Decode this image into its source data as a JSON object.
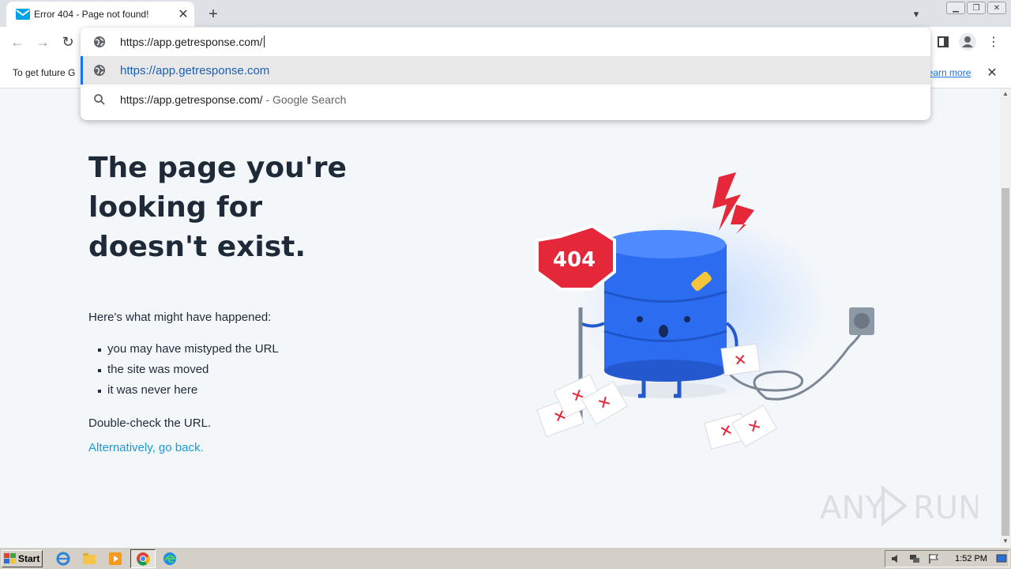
{
  "browser": {
    "tab": {
      "title": "Error 404 - Page not found!",
      "close": "✕"
    },
    "new_tab": "+",
    "window_controls": [
      "▁",
      "❐",
      "✕"
    ],
    "omnibox": {
      "value": "https://app.getresponse.com/",
      "suggestions": [
        {
          "url": "https://app.getresponse.com",
          "suffix": ""
        },
        {
          "url": "https://app.getresponse.com/",
          "suffix": " - Google Search"
        }
      ]
    },
    "infobar": {
      "text": "To get future G",
      "link": "Learn more",
      "close": "✕"
    }
  },
  "page": {
    "headline": "The page you're looking for doesn't exist.",
    "intro": "Here's what might have happened:",
    "reasons": [
      "you may have mistyped the URL",
      "the site was moved",
      "it was never here"
    ],
    "double_check": "Double-check the URL.",
    "go_back": "Alternatively, go back.",
    "sign_text": "404"
  },
  "watermark": {
    "left": "ANY",
    "right": "RUN"
  },
  "taskbar": {
    "start": "Start",
    "clock": "1:52 PM"
  },
  "colors": {
    "accent": "#1a73e8",
    "link": "#1a9bd7",
    "heading": "#1f2a38",
    "page_bg": "#f4f7fa",
    "drum": "#2b6cf0",
    "sign_red": "#e4283a"
  }
}
